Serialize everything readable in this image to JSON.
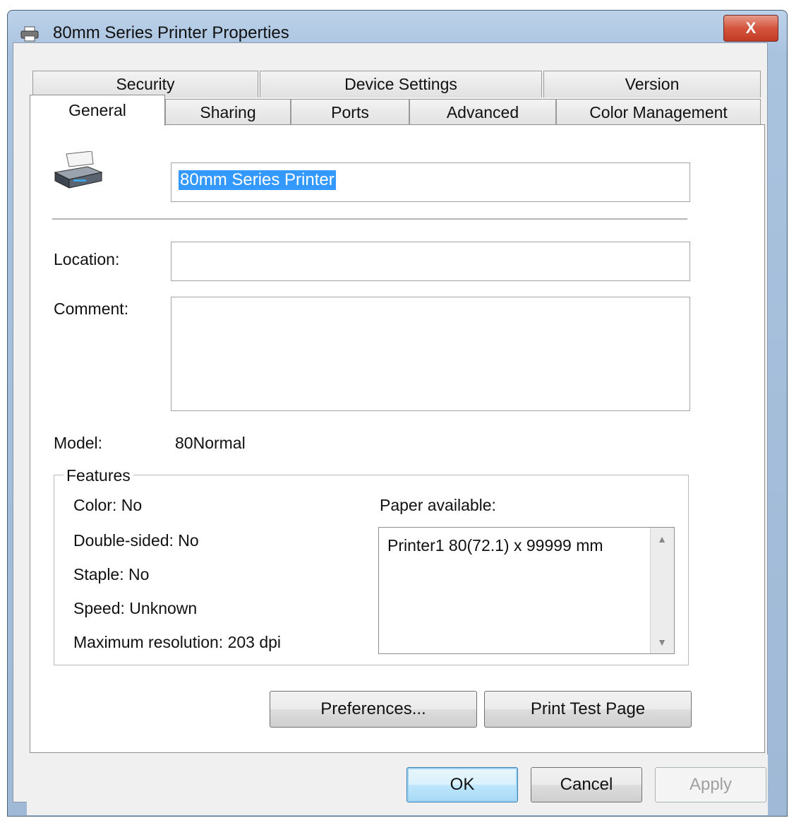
{
  "window": {
    "title": "80mm Series Printer Properties",
    "close_label": "X"
  },
  "tabs": {
    "row1": [
      {
        "label": "Security"
      },
      {
        "label": "Device Settings"
      },
      {
        "label": "Version"
      }
    ],
    "row2": [
      {
        "label": "General",
        "active": true
      },
      {
        "label": "Sharing"
      },
      {
        "label": "Ports"
      },
      {
        "label": "Advanced"
      },
      {
        "label": "Color Management"
      }
    ]
  },
  "general": {
    "printer_name": "80mm Series Printer",
    "location_label": "Location:",
    "location_value": "",
    "comment_label": "Comment:",
    "comment_value": "",
    "model_label": "Model:",
    "model_value": "80Normal"
  },
  "features": {
    "title": "Features",
    "color": "Color: No",
    "double_sided": "Double-sided: No",
    "staple": "Staple: No",
    "speed": "Speed: Unknown",
    "max_resolution": "Maximum resolution: 203 dpi",
    "paper_label": "Paper available:",
    "paper_items": [
      "Printer1 80(72.1) x 99999 mm"
    ]
  },
  "buttons": {
    "preferences": "Preferences...",
    "print_test_page": "Print Test Page",
    "ok": "OK",
    "cancel": "Cancel",
    "apply": "Apply"
  },
  "icons": {
    "title": "printer-icon",
    "close": "close-icon",
    "printer": "printer-icon"
  },
  "colors": {
    "selection": "#3399ff",
    "close_button": "#c43b25",
    "title_bar": "#a9c2de"
  }
}
